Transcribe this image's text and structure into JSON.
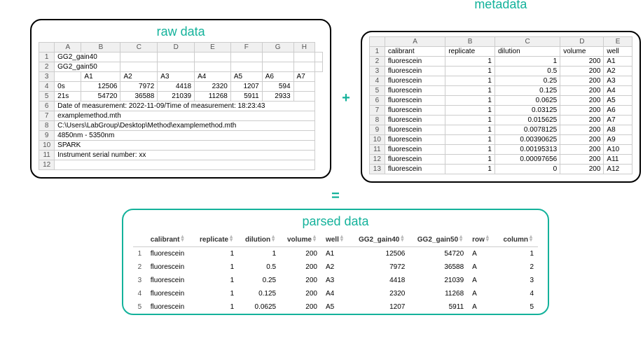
{
  "titles": {
    "raw": "raw data",
    "metadata": "metadata",
    "parsed": "parsed data"
  },
  "operators": {
    "plus": "+",
    "equals": "="
  },
  "raw": {
    "cols": [
      "A",
      "B",
      "C",
      "D",
      "E",
      "F",
      "G",
      "H"
    ],
    "rows": [
      {
        "n": "1",
        "cells": [
          "GG2_gain40",
          "",
          "",
          "",
          "",
          "",
          "",
          ""
        ],
        "spans": [
          2
        ]
      },
      {
        "n": "2",
        "cells": [
          "GG2_gain50",
          "",
          "",
          "",
          "",
          "",
          "",
          ""
        ],
        "spans": [
          2
        ]
      },
      {
        "n": "3",
        "cells": [
          "",
          "A1",
          "A2",
          "A3",
          "A4",
          "A5",
          "A6",
          "A7"
        ]
      },
      {
        "n": "4",
        "cells": [
          "0s",
          "12506",
          "7972",
          "4418",
          "2320",
          "1207",
          "594",
          ""
        ],
        "num": [
          1,
          2,
          3,
          4,
          5,
          6
        ]
      },
      {
        "n": "5",
        "cells": [
          "21s",
          "54720",
          "36588",
          "21039",
          "11268",
          "5911",
          "2933",
          ""
        ],
        "num": [
          1,
          2,
          3,
          4,
          5,
          6
        ]
      },
      {
        "n": "6",
        "cells": [
          "Date of measurement: 2022-11-09/Time of measurement: 18:23:43"
        ],
        "span": 8
      },
      {
        "n": "7",
        "cells": [
          "examplemethod.mth"
        ],
        "span": 8
      },
      {
        "n": "8",
        "cells": [
          "C:\\Users\\LabGroup\\Desktop\\Method\\examplemethod.mth"
        ],
        "span": 8
      },
      {
        "n": "9",
        "cells": [
          "4850nm - 5350nm"
        ],
        "span": 8
      },
      {
        "n": "10",
        "cells": [
          "SPARK"
        ],
        "span": 8
      },
      {
        "n": "11",
        "cells": [
          "Instrument serial number: xx"
        ],
        "span": 8
      },
      {
        "n": "12",
        "cells": [
          ""
        ],
        "span": 8
      }
    ]
  },
  "metadata": {
    "cols": [
      "A",
      "B",
      "C",
      "D",
      "E"
    ],
    "header_row": {
      "n": "1",
      "cells": [
        "calibrant",
        "replicate",
        "dilution",
        "volume",
        "well"
      ]
    },
    "rows": [
      {
        "n": "2",
        "calibrant": "fluorescein",
        "replicate": "1",
        "dilution": "1",
        "volume": "200",
        "well": "A1"
      },
      {
        "n": "3",
        "calibrant": "fluorescein",
        "replicate": "1",
        "dilution": "0.5",
        "volume": "200",
        "well": "A2"
      },
      {
        "n": "4",
        "calibrant": "fluorescein",
        "replicate": "1",
        "dilution": "0.25",
        "volume": "200",
        "well": "A3"
      },
      {
        "n": "5",
        "calibrant": "fluorescein",
        "replicate": "1",
        "dilution": "0.125",
        "volume": "200",
        "well": "A4"
      },
      {
        "n": "6",
        "calibrant": "fluorescein",
        "replicate": "1",
        "dilution": "0.0625",
        "volume": "200",
        "well": "A5"
      },
      {
        "n": "7",
        "calibrant": "fluorescein",
        "replicate": "1",
        "dilution": "0.03125",
        "volume": "200",
        "well": "A6"
      },
      {
        "n": "8",
        "calibrant": "fluorescein",
        "replicate": "1",
        "dilution": "0.015625",
        "volume": "200",
        "well": "A7"
      },
      {
        "n": "9",
        "calibrant": "fluorescein",
        "replicate": "1",
        "dilution": "0.0078125",
        "volume": "200",
        "well": "A8"
      },
      {
        "n": "10",
        "calibrant": "fluorescein",
        "replicate": "1",
        "dilution": "0.00390625",
        "volume": "200",
        "well": "A9"
      },
      {
        "n": "11",
        "calibrant": "fluorescein",
        "replicate": "1",
        "dilution": "0.00195313",
        "volume": "200",
        "well": "A10"
      },
      {
        "n": "12",
        "calibrant": "fluorescein",
        "replicate": "1",
        "dilution": "0.00097656",
        "volume": "200",
        "well": "A11"
      },
      {
        "n": "13",
        "calibrant": "fluorescein",
        "replicate": "1",
        "dilution": "0",
        "volume": "200",
        "well": "A12"
      }
    ]
  },
  "parsed": {
    "headers": [
      "",
      "calibrant",
      "replicate",
      "dilution",
      "volume",
      "well",
      "GG2_gain40",
      "GG2_gain50",
      "row",
      "column"
    ],
    "rows": [
      {
        "n": "1",
        "calibrant": "fluorescein",
        "replicate": "1",
        "dilution": "1",
        "volume": "200",
        "well": "A1",
        "g40": "12506",
        "g50": "54720",
        "row": "A",
        "col": "1"
      },
      {
        "n": "2",
        "calibrant": "fluorescein",
        "replicate": "1",
        "dilution": "0.5",
        "volume": "200",
        "well": "A2",
        "g40": "7972",
        "g50": "36588",
        "row": "A",
        "col": "2"
      },
      {
        "n": "3",
        "calibrant": "fluorescein",
        "replicate": "1",
        "dilution": "0.25",
        "volume": "200",
        "well": "A3",
        "g40": "4418",
        "g50": "21039",
        "row": "A",
        "col": "3"
      },
      {
        "n": "4",
        "calibrant": "fluorescein",
        "replicate": "1",
        "dilution": "0.125",
        "volume": "200",
        "well": "A4",
        "g40": "2320",
        "g50": "11268",
        "row": "A",
        "col": "4"
      },
      {
        "n": "5",
        "calibrant": "fluorescein",
        "replicate": "1",
        "dilution": "0.0625",
        "volume": "200",
        "well": "A5",
        "g40": "1207",
        "g50": "5911",
        "row": "A",
        "col": "5"
      }
    ]
  }
}
